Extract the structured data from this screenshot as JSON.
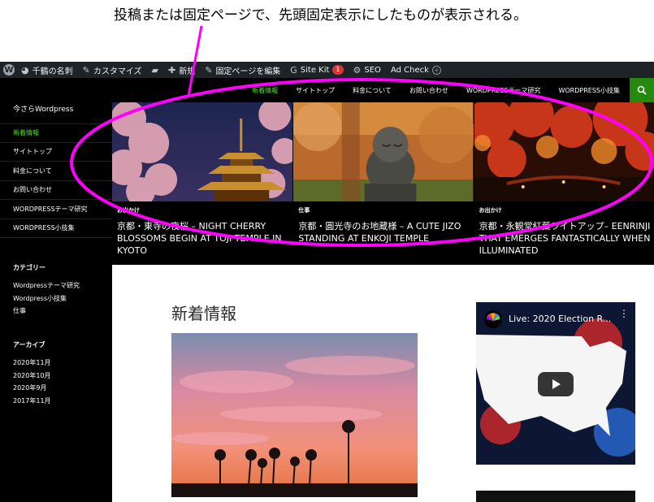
{
  "annotation": {
    "caption": "投稿または固定ページで、先頭固定表示にしたものが表示される。"
  },
  "admin_bar": {
    "wp_logo": "W",
    "site_name": "千鶴の名刺",
    "customize": "カスタマイズ",
    "new": "新規",
    "edit_page": "固定ページを編集",
    "site_kit": "Site Kit",
    "site_kit_badge": "1",
    "seo": "SEO",
    "ad_check": "Ad Check"
  },
  "sidebar": {
    "site_title": "今さらWordpress",
    "nav": [
      "新着情報",
      "サイトトップ",
      "料金について",
      "お問い合わせ",
      "WORDPRESSテーマ研究",
      "WORDPRESS小技集"
    ],
    "categories_title": "カテゴリー",
    "categories": [
      "Wordpressテーマ研究",
      "Wordpress小技集",
      "仕事"
    ],
    "archives_title": "アーカイブ",
    "archives": [
      "2020年11月",
      "2020年10月",
      "2020年9月",
      "2017年11月"
    ]
  },
  "topnav": {
    "items": [
      "新着情報",
      "サイトトップ",
      "料金について",
      "お問い合わせ",
      "WORDPRESSテーマ研究",
      "WORDPRESS小技集"
    ]
  },
  "featured": [
    {
      "category": "お出かけ",
      "title": "京都・東寺の夜桜 – NIGHT CHERRY BLOSSOMS BEGIN AT TOJI TEMPLE IN KYOTO"
    },
    {
      "category": "仕事",
      "title": "京都・圓光寺のお地蔵様 – A CUTE JIZO STANDING AT ENKOJI TEMPLE"
    },
    {
      "category": "お出かけ",
      "title": "京都・永観堂紅葉ライトアップ– EENRINJI THAT EMERGES FANTASTICALLY WHEN ILLUMINATED"
    }
  ],
  "main": {
    "heading": "新着情報"
  },
  "video": {
    "title": "Live: 2020 Election R..."
  },
  "colors": {
    "accent": "#55d737",
    "search_bg": "#24890d",
    "annotation_oval": "#ff00ff"
  }
}
